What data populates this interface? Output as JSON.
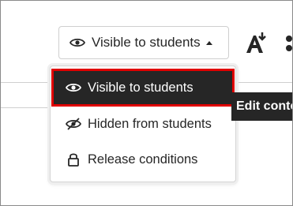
{
  "visibility_button": {
    "label": "Visible to students",
    "icon": "eye-icon"
  },
  "menu": {
    "items": [
      {
        "label": "Visible to students",
        "icon": "eye-icon",
        "selected": true
      },
      {
        "label": "Hidden from students",
        "icon": "eye-slash-icon",
        "selected": false
      },
      {
        "label": "Release conditions",
        "icon": "lock-icon",
        "selected": false
      }
    ]
  },
  "tooltip": {
    "text": "Edit conte"
  },
  "colors": {
    "selected_bg": "#262626",
    "highlight_outline": "#e00000",
    "text": "#262626"
  }
}
